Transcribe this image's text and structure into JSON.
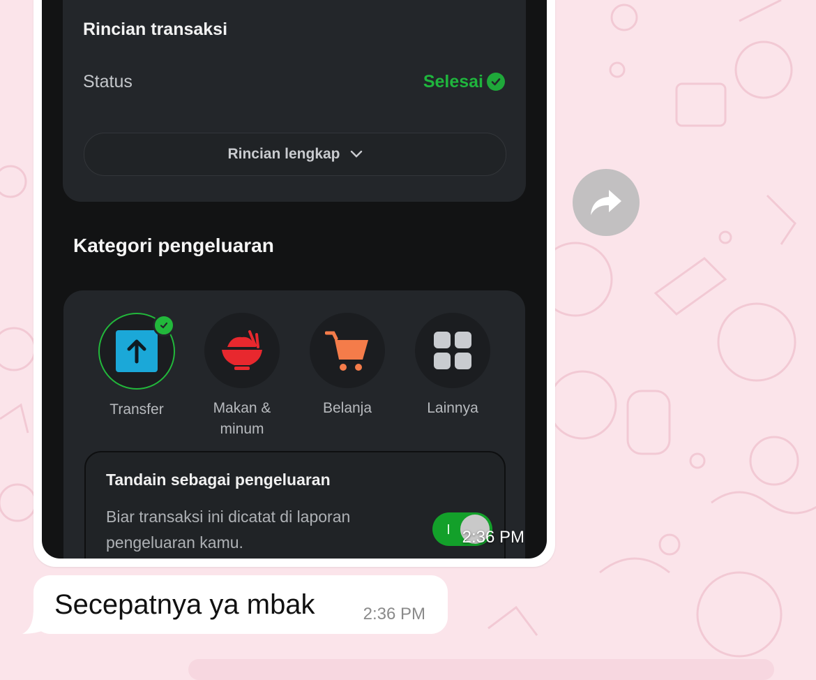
{
  "image_message": {
    "card_top": {
      "title": "Rincian transaksi",
      "status_label": "Status",
      "status_value": "Selesai",
      "detail_button": "Rincian lengkap"
    },
    "kategori": {
      "title": "Kategori pengeluaran",
      "items": [
        {
          "label": "Transfer",
          "icon": "transfer-up-arrow-icon",
          "selected": true
        },
        {
          "label": "Makan & minum",
          "icon": "rice-bowl-icon",
          "selected": false
        },
        {
          "label": "Belanja",
          "icon": "shopping-cart-icon",
          "selected": false
        },
        {
          "label": "Lainnya",
          "icon": "grid-icon",
          "selected": false
        }
      ]
    },
    "mark_expense": {
      "title": "Tandain sebagai pengeluaran",
      "description": "Biar transaksi ini dicatat di laporan pengeluaran kamu.",
      "toggle_on": true
    },
    "time": "2:36 PM"
  },
  "text_message": {
    "text": "Secepatnya ya mbak",
    "time": "2:36 PM"
  },
  "colors": {
    "chat_background": "#fbe4ea",
    "success_green": "#1fb53d",
    "transfer_blue": "#1ba8d8",
    "food_red": "#e8282e",
    "shop_orange": "#f47c4a"
  }
}
